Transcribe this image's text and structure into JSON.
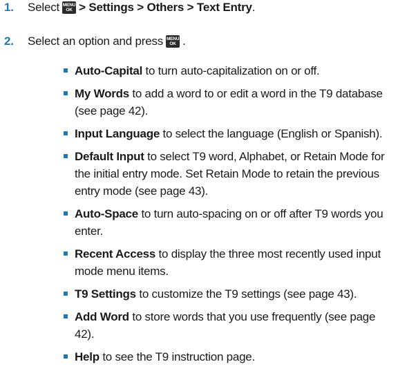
{
  "steps": [
    {
      "number": "1.",
      "prefix": "Select",
      "key_top": "MENU",
      "key_bottom": "OK",
      "path": "> Settings > Others > Text Entry",
      "suffix": "."
    },
    {
      "number": "2.",
      "text": "Select an option and press",
      "key_top": "MENU",
      "key_bottom": "OK",
      "suffix": "."
    }
  ],
  "options": [
    {
      "term": "Auto-Capital",
      "desc": " to turn auto-capitalization on or off."
    },
    {
      "term": "My Words",
      "desc": " to add a word to or edit a word in the T9 database (see page 42)."
    },
    {
      "term": "Input Language",
      "desc": " to select the language (English or Spanish)."
    },
    {
      "term": "Default Input",
      "desc": " to select T9 word, Alphabet, or Retain Mode for the initial entry mode. Set Retain Mode to retain the previous entry mode (see page 43)."
    },
    {
      "term": "Auto-Space",
      "desc": " to turn auto-spacing on or off after T9 words you enter."
    },
    {
      "term": "Recent Access",
      "desc": " to display the three most recently used input mode menu items."
    },
    {
      "term": "T9 Settings",
      "desc": " to customize the T9 settings (see page 43)."
    },
    {
      "term": "Add Word",
      "desc": " to store words that you use frequently (see page 42)."
    },
    {
      "term": "Help",
      "desc": " to see the T9 instruction page."
    }
  ],
  "colors": {
    "accent": "#1f78b4",
    "key_bg": "#2a2a2a"
  }
}
